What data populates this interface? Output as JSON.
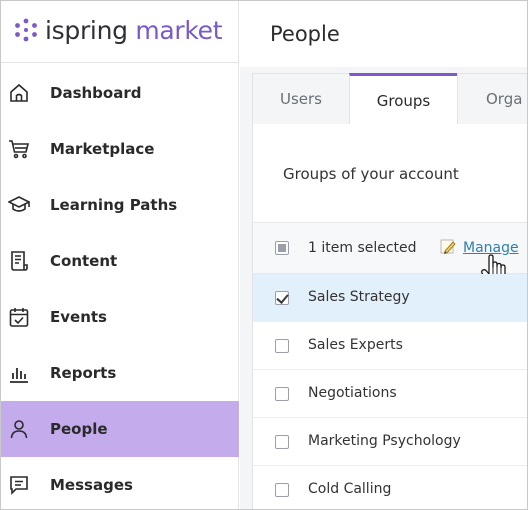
{
  "logo": {
    "prefix": "ispring",
    "suffix": "market"
  },
  "sidebar": {
    "items": [
      {
        "label": "Dashboard",
        "icon": "home-icon"
      },
      {
        "label": "Marketplace",
        "icon": "cart-icon"
      },
      {
        "label": "Learning Paths",
        "icon": "graduation-cap-icon"
      },
      {
        "label": "Content",
        "icon": "document-icon"
      },
      {
        "label": "Events",
        "icon": "calendar-check-icon"
      },
      {
        "label": "Reports",
        "icon": "bar-chart-icon"
      },
      {
        "label": "People",
        "icon": "person-icon",
        "active": true
      },
      {
        "label": "Messages",
        "icon": "chat-icon"
      }
    ]
  },
  "header": {
    "title": "People"
  },
  "tabs": [
    {
      "label": "Users"
    },
    {
      "label": "Groups",
      "active": true
    },
    {
      "label": "Orga"
    }
  ],
  "panel": {
    "heading": "Groups of your account",
    "toolbar": {
      "selected_text": "1 item selected",
      "manage_label": "Manage"
    },
    "rows": [
      {
        "label": "Sales Strategy",
        "checked": true
      },
      {
        "label": "Sales Experts",
        "checked": false
      },
      {
        "label": "Negotiations",
        "checked": false
      },
      {
        "label": "Marketing Psychology",
        "checked": false
      },
      {
        "label": "Cold Calling",
        "checked": false
      }
    ]
  },
  "colors": {
    "accent": "#7a5ac8",
    "active_nav_bg": "#c3abec",
    "selected_row_bg": "#e2f0fb",
    "link": "#2f7fb6"
  }
}
